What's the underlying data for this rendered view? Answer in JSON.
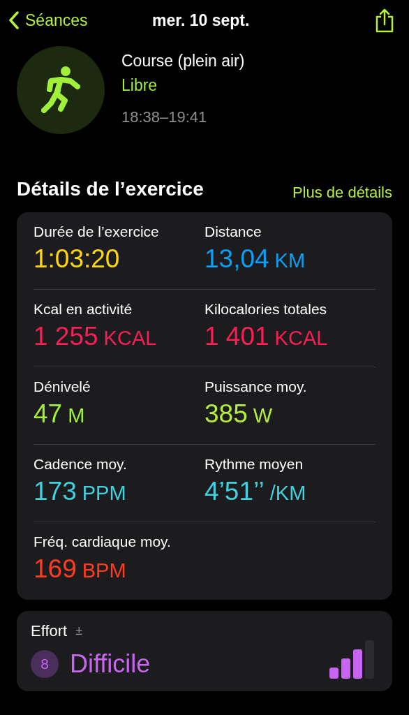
{
  "nav": {
    "back": "Séances",
    "title": "mer. 10 sept."
  },
  "workout": {
    "name": "Course (plein air)",
    "type": "Libre",
    "time": "18:38–19:41"
  },
  "section": {
    "title": "Détails de l’exercice",
    "link": "Plus de détails"
  },
  "metrics": [
    {
      "label": "Durée de l’exercice",
      "value": "1:03:20",
      "color": "#ffd60a"
    },
    {
      "label": "Distance",
      "value": "13,04",
      "unit": "KM",
      "color": "#0a9ff5"
    },
    {
      "label": "Kcal en activité",
      "value": "1 255",
      "unit": "KCAL",
      "color": "#fa1e56"
    },
    {
      "label": "Kilocalories totales",
      "value": "1 401",
      "unit": "KCAL",
      "color": "#fa1e56"
    },
    {
      "label": "Dénivelé",
      "value": "47",
      "unit": "M",
      "color": "#a0f03a"
    },
    {
      "label": "Puissance moy.",
      "value": "385",
      "unit": "W",
      "color": "#b5f03a"
    },
    {
      "label": "Cadence moy.",
      "value": "173",
      "unit": "PPM",
      "color": "#40d0e0"
    },
    {
      "label": "Rythme moyen",
      "value": "4’51’’",
      "unit": "/KM",
      "color": "#40d0e0"
    },
    {
      "label": "Fréq. cardiaque moy.",
      "value": "169",
      "unit": "BPM",
      "color": "#ff3b20"
    }
  ],
  "effort": {
    "label": "Effort",
    "sign": "±",
    "score": "8",
    "rating": "Difficile",
    "level": 0.75
  }
}
